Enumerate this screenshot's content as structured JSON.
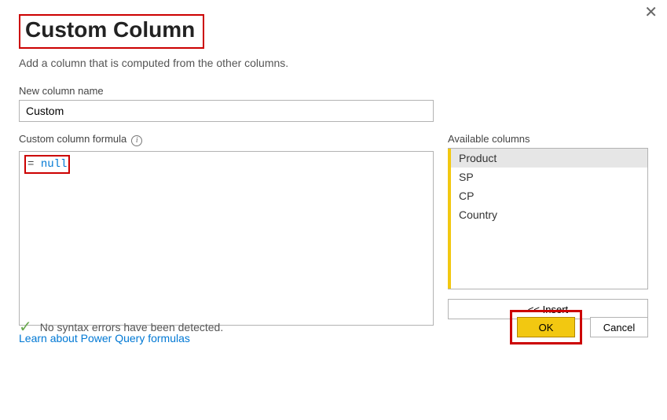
{
  "dialog": {
    "title": "Custom Column",
    "subtitle": "Add a column that is computed from the other columns.",
    "close_icon": "✕"
  },
  "name_field": {
    "label": "New column name",
    "value": "Custom"
  },
  "formula": {
    "label": "Custom column formula",
    "equals": "=",
    "keyword": "null"
  },
  "available": {
    "label": "Available columns",
    "items": [
      "Product",
      "SP",
      "CP",
      "Country"
    ],
    "insert_label": "<< Insert"
  },
  "link": {
    "text": "Learn about Power Query formulas"
  },
  "status": {
    "text": "No syntax errors have been detected."
  },
  "buttons": {
    "ok": "OK",
    "cancel": "Cancel"
  }
}
